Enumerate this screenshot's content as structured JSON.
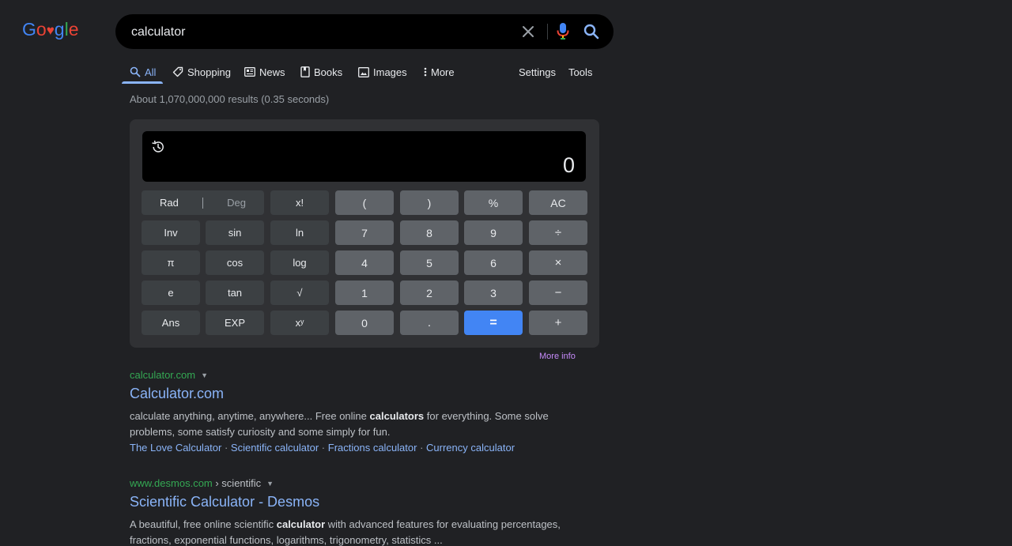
{
  "logo": {
    "letters": [
      "G",
      "o",
      "♥",
      "g",
      "l",
      "e"
    ],
    "colors": [
      "#4285f4",
      "#ea4335",
      "#ea4335",
      "#4285f4",
      "#34a853",
      "#ea4335"
    ]
  },
  "search": {
    "query": "calculator",
    "icons": [
      "close-icon",
      "microphone-icon",
      "search-icon"
    ]
  },
  "tabs": {
    "all": "All",
    "shopping": "Shopping",
    "news": "News",
    "books": "Books",
    "images": "Images",
    "more": "More",
    "settings": "Settings",
    "tools": "Tools"
  },
  "stats": "About 1,070,000,000 results (0.35 seconds)",
  "calculator": {
    "display": "0",
    "rad": "Rad",
    "deg": "Deg",
    "keys": {
      "fact": "x!",
      "lparen": "(",
      "rparen": ")",
      "percent": "%",
      "ac": "AC",
      "inv": "Inv",
      "sin": "sin",
      "ln": "ln",
      "k7": "7",
      "k8": "8",
      "k9": "9",
      "div": "÷",
      "pi": "π",
      "cos": "cos",
      "log": "log",
      "k4": "4",
      "k5": "5",
      "k6": "6",
      "mul": "×",
      "e": "e",
      "tan": "tan",
      "sqrt": "√",
      "k1": "1",
      "k2": "2",
      "k3": "3",
      "minus": "−",
      "ans": "Ans",
      "exp": "EXP",
      "pow": "xʸ",
      "k0": "0",
      "dot": ".",
      "eq": "=",
      "plus": "+"
    },
    "more_info": "More info",
    "accent": "#4285f4"
  },
  "results": [
    {
      "domain": "calculator.com",
      "path": "",
      "title": "Calculator.com",
      "snippet_1a": "calculate anything, anytime, anywhere... Free online ",
      "snippet_1b": "calculators",
      "snippet_1c": " for everything. Some solve",
      "snippet_2": "problems, some satisfy curiosity and some simply for fun.",
      "sitelinks": [
        "The Love Calculator",
        "Scientific calculator",
        "Fractions calculator",
        "Currency calculator"
      ]
    },
    {
      "domain": "www.desmos.com",
      "path": " › scientific",
      "title": "Scientific Calculator - Desmos",
      "snippet_1a": "A beautiful, free online scientific ",
      "snippet_1b": "calculator",
      "snippet_1c": " with advanced features for evaluating percentages,",
      "snippet_2": "fractions, exponential functions, logarithms, trigonometry, statistics ..."
    }
  ]
}
